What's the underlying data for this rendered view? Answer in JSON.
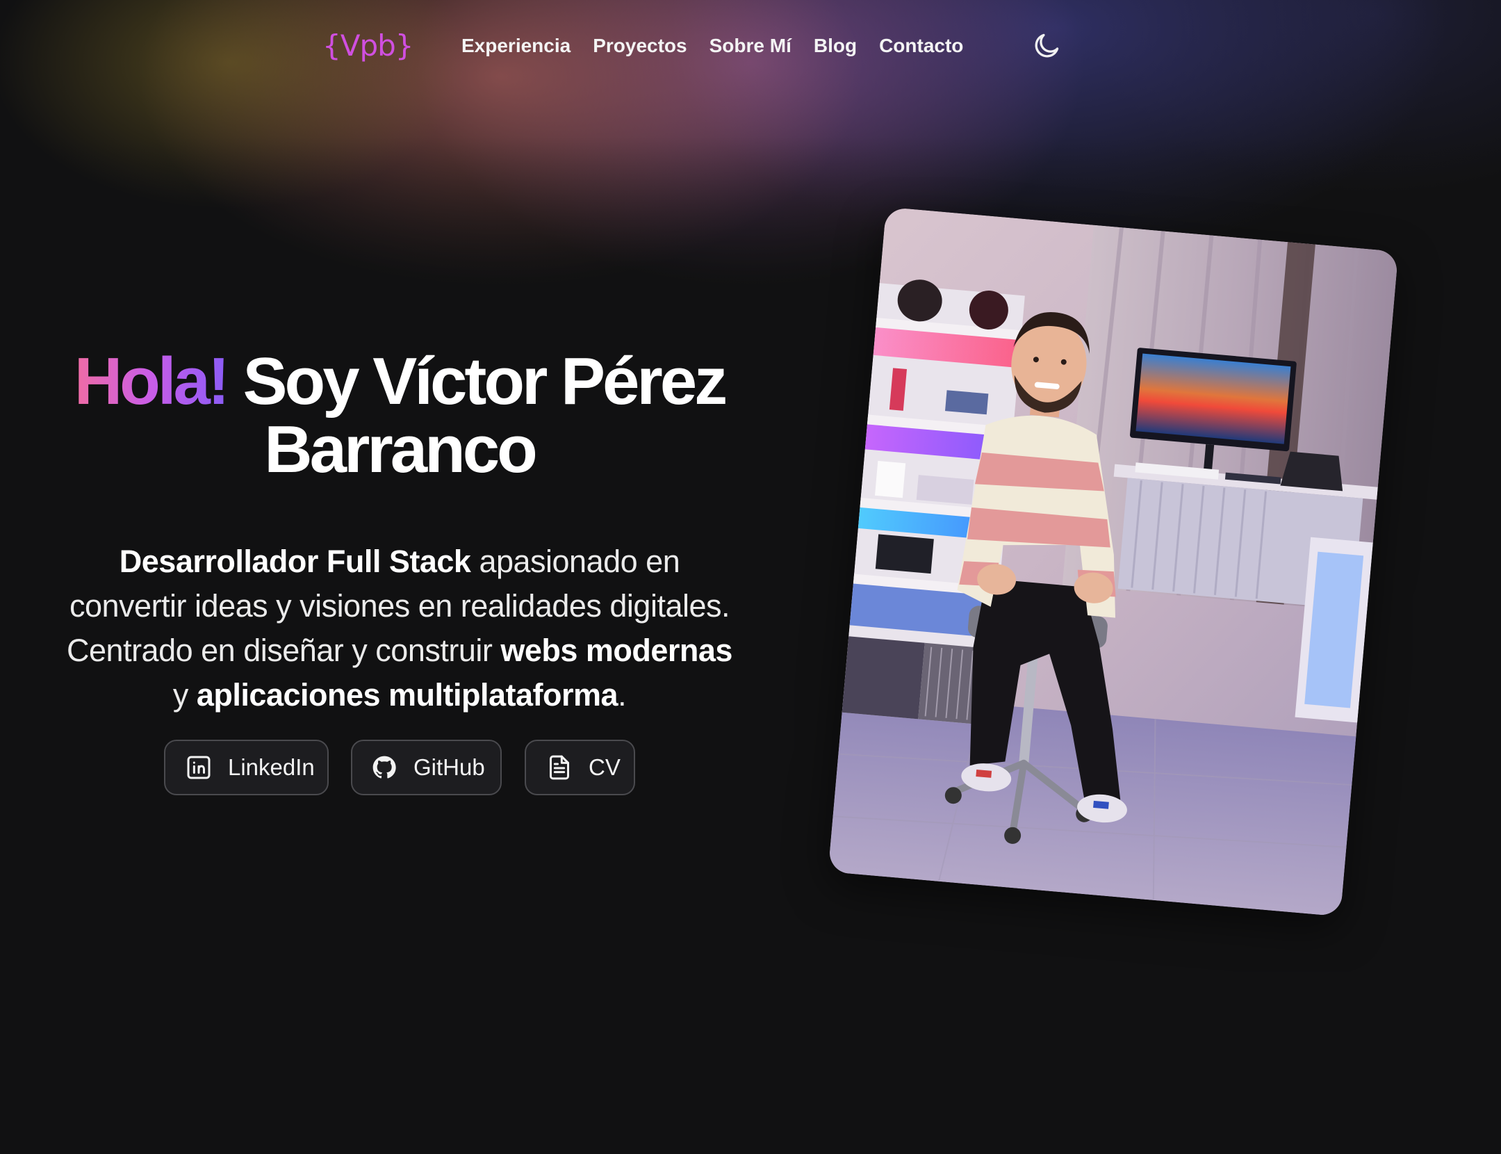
{
  "nav": {
    "logo": "{Vpb}",
    "links": [
      "Experiencia",
      "Proyectos",
      "Sobre Mí",
      "Blog",
      "Contacto"
    ],
    "theme_icon": "moon-icon"
  },
  "hero": {
    "greeting": "Hola!",
    "name_line1": "Soy Víctor Pérez",
    "name_line2": "Barranco",
    "desc": {
      "role": "Desarrollador Full Stack",
      "part1": " apasionado en convertir ideas y visiones en realidades digitales. Centrado en diseñar y construir ",
      "webs": "webs modernas",
      "part2": " y ",
      "apps": "aplicaciones multiplataforma",
      "end": "."
    }
  },
  "social": {
    "linkedin": {
      "label": "LinkedIn",
      "icon": "linkedin-icon"
    },
    "github": {
      "label": "GitHub",
      "icon": "github-icon"
    },
    "cv": {
      "label": "CV",
      "icon": "document-icon"
    }
  },
  "photo": {
    "subject": "profile-photo"
  },
  "colors": {
    "background": "#111112",
    "accent": "#d04fe0",
    "gradient_start": "#f06ca4",
    "gradient_end": "#8b5cf6"
  }
}
